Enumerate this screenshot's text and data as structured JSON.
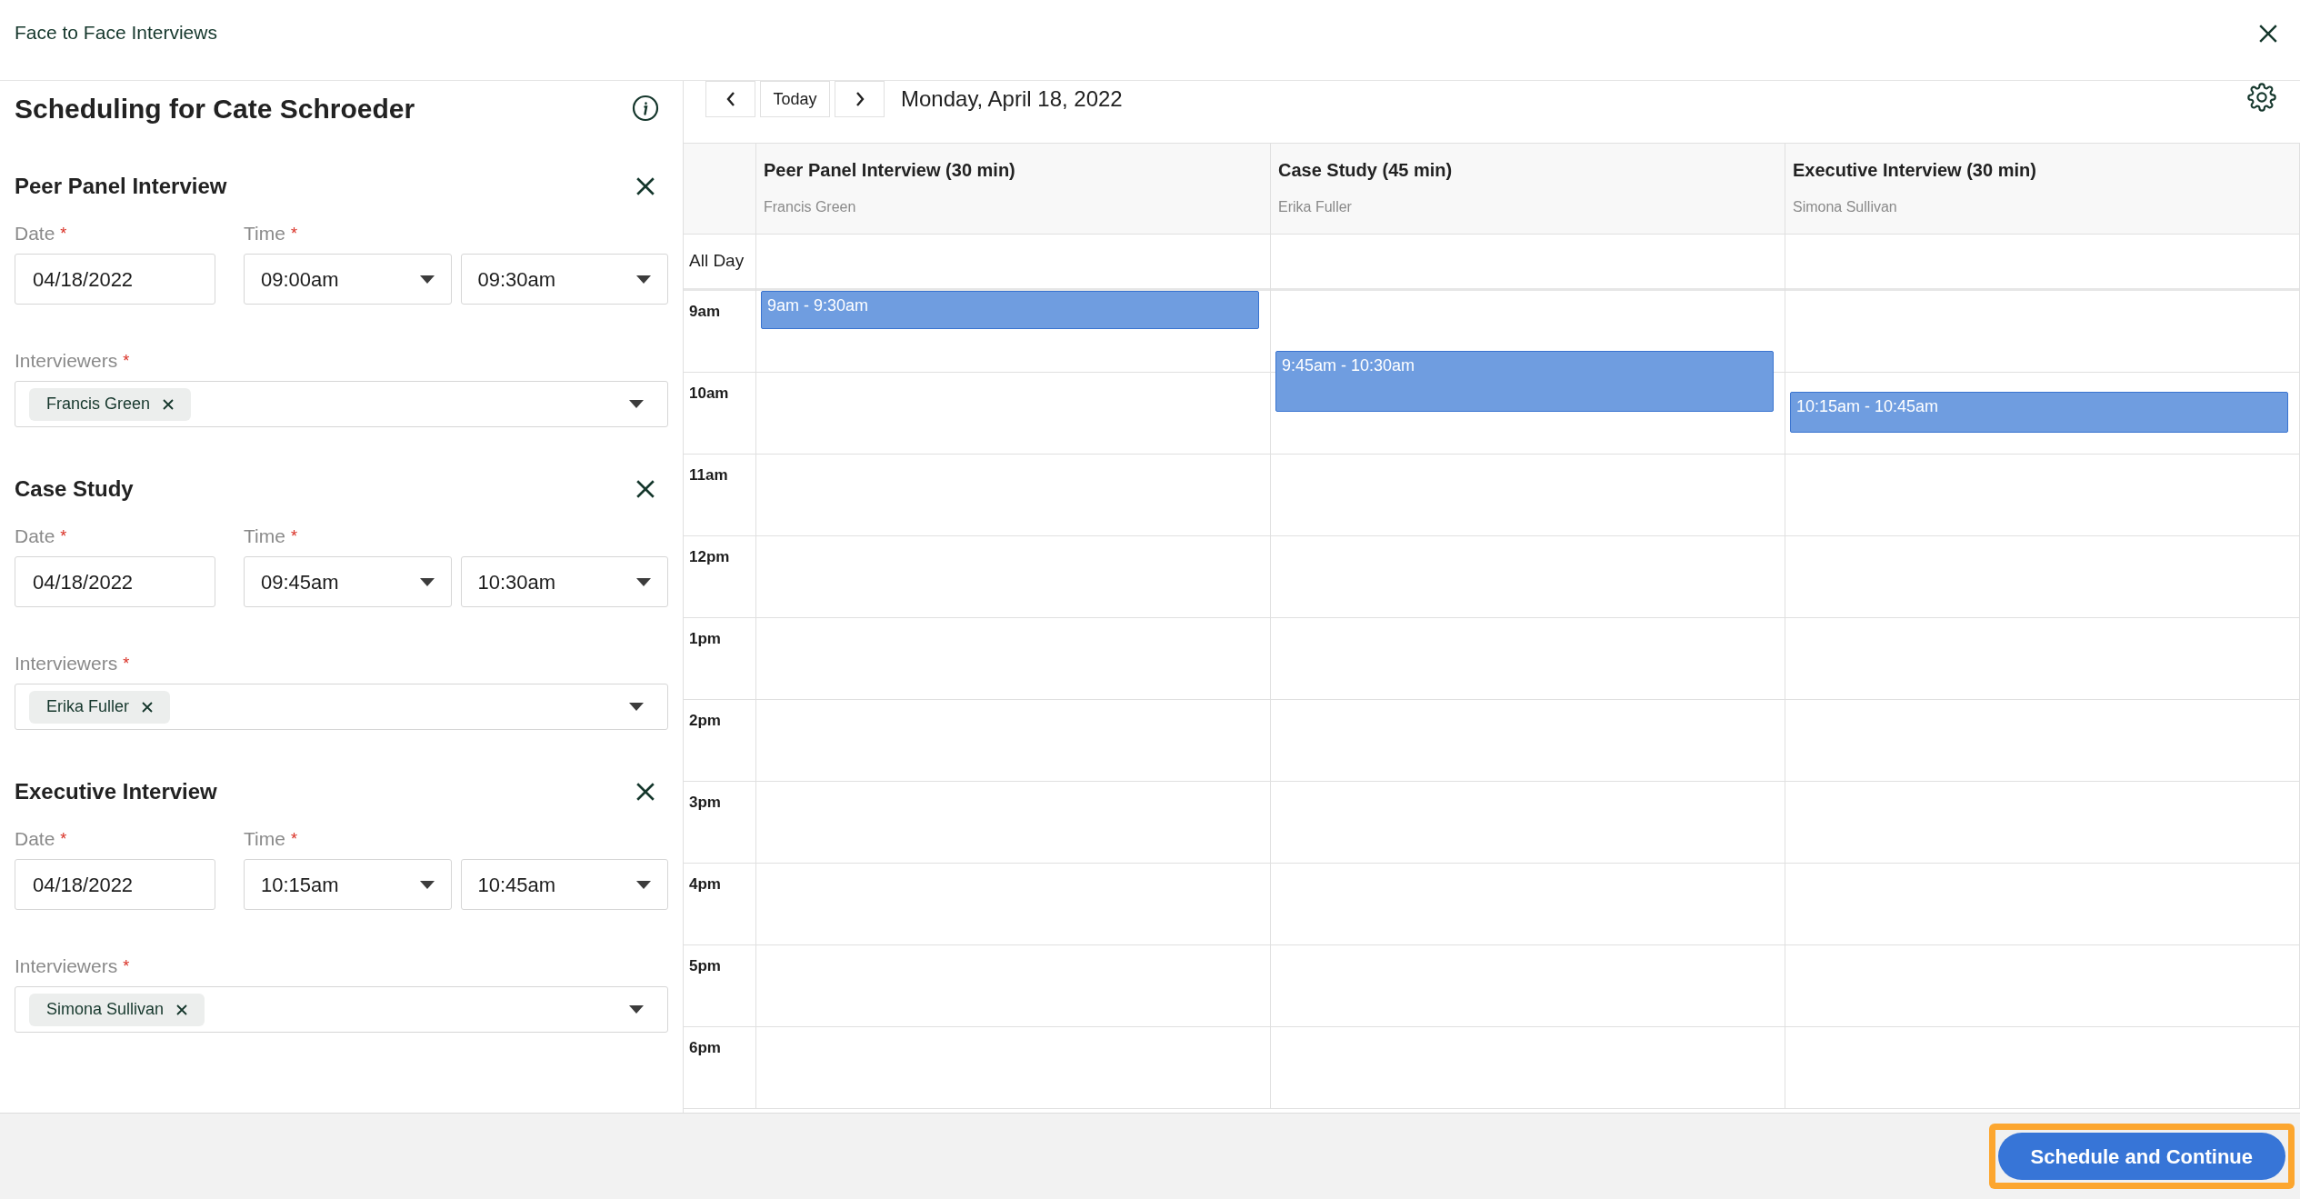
{
  "window": {
    "title": "Face to Face Interviews"
  },
  "scheduling": {
    "heading": "Scheduling for Cate Schroeder"
  },
  "interviews": [
    {
      "title": "Peer Panel Interview",
      "date_label": {
        "text": "Date",
        "required": "*"
      },
      "date": "04/18/2022",
      "time_label": {
        "text": "Time",
        "required": "*"
      },
      "start_time": "09:00am",
      "end_time": "09:30am",
      "interviewers_label": {
        "text": "Interviewers",
        "required": "*"
      },
      "interviewers": [
        "Francis Green"
      ]
    },
    {
      "title": "Case Study",
      "date_label": {
        "text": "Date",
        "required": "*"
      },
      "date": "04/18/2022",
      "time_label": {
        "text": "Time",
        "required": "*"
      },
      "start_time": "09:45am",
      "end_time": "10:30am",
      "interviewers_label": {
        "text": "Interviewers",
        "required": "*"
      },
      "interviewers": [
        "Erika Fuller"
      ]
    },
    {
      "title": "Executive Interview",
      "date_label": {
        "text": "Date",
        "required": "*"
      },
      "date": "04/18/2022",
      "time_label": {
        "text": "Time",
        "required": "*"
      },
      "start_time": "10:15am",
      "end_time": "10:45am",
      "interviewers_label": {
        "text": "Interviewers",
        "required": "*"
      },
      "interviewers": [
        "Simona Sullivan"
      ]
    }
  ],
  "calendar": {
    "today_button": "Today",
    "date": "Monday, April 18, 2022",
    "all_day_label": "All Day",
    "columns": [
      {
        "title": "Peer Panel Interview (30 min)",
        "interviewer": "Francis Green",
        "events": [
          {
            "label": "9am - 9:30am"
          }
        ]
      },
      {
        "title": "Case Study (45 min)",
        "interviewer": "Erika Fuller",
        "events": [
          {
            "label": "9:45am - 10:30am"
          }
        ]
      },
      {
        "title": "Executive Interview (30 min)",
        "interviewer": "Simona Sullivan",
        "events": [
          {
            "label": "10:15am - 10:45am"
          }
        ]
      }
    ],
    "hours": [
      "9am",
      "10am",
      "11am",
      "12pm",
      "1pm",
      "2pm",
      "3pm",
      "4pm",
      "5pm",
      "6pm"
    ]
  },
  "footer": {
    "primary_button": "Schedule and Continue",
    "highlighted": true
  }
}
